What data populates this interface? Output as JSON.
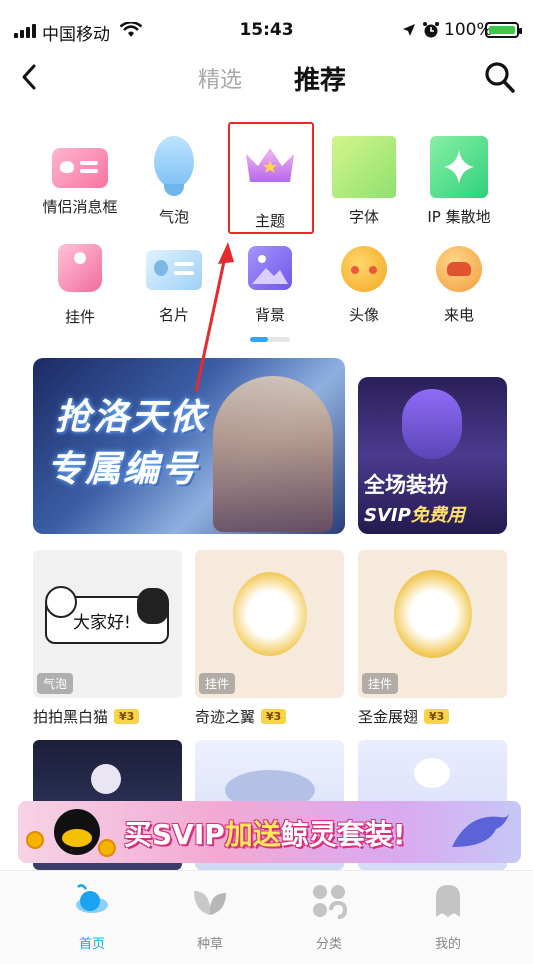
{
  "status_bar": {
    "carrier": "中国移动",
    "time": "15:43",
    "battery": "100%"
  },
  "header": {
    "tabs": [
      "精选",
      "推荐"
    ],
    "active_tab": "推荐"
  },
  "categories": [
    {
      "label": "情侣消息框",
      "icon": "couple-message-icon"
    },
    {
      "label": "气泡",
      "icon": "bubble-icon"
    },
    {
      "label": "主题",
      "icon": "crown-theme-icon"
    },
    {
      "label": "字体",
      "icon": "font-icon"
    },
    {
      "label": "IP 集散地",
      "icon": "ip-hub-icon"
    },
    {
      "label": "挂件",
      "icon": "pendant-icon"
    },
    {
      "label": "名片",
      "icon": "card-icon"
    },
    {
      "label": "背景",
      "icon": "background-icon"
    },
    {
      "label": "头像",
      "icon": "avatar-icon"
    },
    {
      "label": "来电",
      "icon": "phone-icon"
    }
  ],
  "banners": {
    "main": {
      "line1": "抢洛天依",
      "line2": "专属编号"
    },
    "side": {
      "line1": "全场装扮",
      "line2_prefix": "SVIP",
      "line2_suffix": "免费用"
    }
  },
  "items": [
    {
      "name": "拍拍黑白猫",
      "tag": "气泡",
      "price": "¥3",
      "bubble_text": "大家好!"
    },
    {
      "name": "奇迹之翼",
      "tag": "挂件",
      "price": "¥3"
    },
    {
      "name": "圣金展翅",
      "tag": "挂件",
      "price": "¥3"
    }
  ],
  "promo": {
    "prefix": "买SVIP",
    "highlight": "加送",
    "suffix": "鲸灵套装!"
  },
  "bottom_nav": [
    {
      "label": "首页",
      "active": true
    },
    {
      "label": "种草",
      "active": false
    },
    {
      "label": "分类",
      "active": false
    },
    {
      "label": "我的",
      "active": false
    }
  ],
  "colors": {
    "accent": "#1aa3f0",
    "highlight_box": "#e52b2b",
    "price_badge": "#fbd34a"
  }
}
